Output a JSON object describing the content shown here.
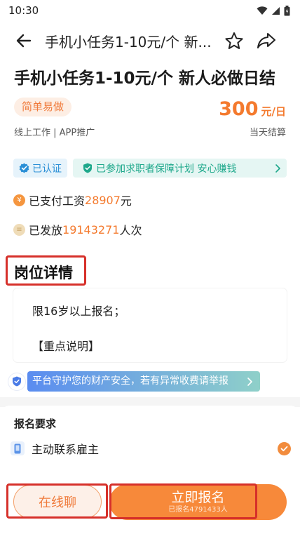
{
  "status": {
    "time": "10:30"
  },
  "topbar": {
    "title": "手机小任务1-10元/个 新..."
  },
  "job": {
    "title": "手机小任务1-10元/个 新人必做日结",
    "tag": "简单易做",
    "meta": "线上工作 | APP推广",
    "salary_amount": "300",
    "salary_unit": "元/日",
    "settlement": "当天结算"
  },
  "verify": {
    "verified_label": "已认证",
    "plan_label": "已参加求职者保障计划 安心赚钱"
  },
  "stats": {
    "wages_prefix": "已支付工资",
    "wages_value": "28907",
    "wages_suffix": "元",
    "issued_prefix": "已发放",
    "issued_value": "19143271",
    "issued_suffix": "人次"
  },
  "detail": {
    "section_title": "岗位详情",
    "line1": "限16岁以上报名；",
    "line2": "【重点说明】"
  },
  "safety": {
    "text": "平台守护您的财产安全，若有异常收费请举报"
  },
  "requirements": {
    "title": "报名要求",
    "item1": "主动联系雇主"
  },
  "bottom": {
    "chat_label": "在线聊",
    "apply_label": "立即报名",
    "apply_count": "已报名4791433人"
  },
  "colors": {
    "accent": "#f47a2e",
    "highlight_box": "#d6302a",
    "verified_blue": "#2a8fd6",
    "plan_green": "#1ea88b"
  }
}
